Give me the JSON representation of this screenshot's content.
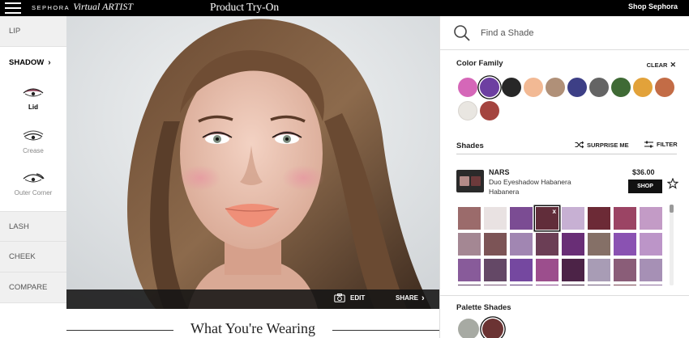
{
  "topbar": {
    "brand_line1": "SEPHORA",
    "brand_line2": "Virtual ARTIST",
    "title": "Product Try-On",
    "shop_link": "Shop Sephora"
  },
  "left_nav": {
    "lip": "LIP",
    "shadow": "SHADOW",
    "shadow_sub": [
      "Lid",
      "Crease",
      "Outer Corner"
    ],
    "lash": "LASH",
    "cheek": "CHEEK",
    "compare": "COMPARE",
    "selected_sub": "Lid"
  },
  "photo_bar": {
    "edit": "EDIT",
    "share": "SHARE"
  },
  "wearing_heading": "What You're Wearing",
  "search": {
    "placeholder": "Find a Shade"
  },
  "color_family": {
    "label": "Color Family",
    "clear": "CLEAR",
    "swatches": [
      "#d567b8",
      "#6d3fa1",
      "#272727",
      "#f2b994",
      "#b09078",
      "#3d3f86",
      "#646464",
      "#3f6a35",
      "#e2a23a",
      "#c36c46",
      "#e9e6e1",
      "#a4443f"
    ],
    "selected_index": 1
  },
  "shades": {
    "label": "Shades",
    "surprise": "SURPRISE ME",
    "filter": "FILTER"
  },
  "product": {
    "brand": "NARS",
    "name": "Duo Eyeshadow Habanera",
    "shade": "Habanera",
    "price": "$36.00",
    "shop_button": "SHOP"
  },
  "shade_grid": {
    "colors": [
      "#9b6b6b",
      "#e9e2e2",
      "#7b4c93",
      "#612d3a",
      "#c7b0d3",
      "#6c2a36",
      "#9b4464",
      "#c39bc6",
      "#a48793",
      "#7c5456",
      "#a186b2",
      "#6b3e55",
      "#692e76",
      "#857067",
      "#8a52b2",
      "#bc95c8",
      "#885b9a",
      "#644866",
      "#7548a0",
      "#9c4e8d",
      "#4c2347",
      "#a89cb5",
      "#8a5d78",
      "#a690b5",
      "#5a3a62",
      "#7b5a7b",
      "#5d3a7a",
      "#8a4b8f",
      "#3c1c3c",
      "#6f5b7c",
      "#76424f",
      "#8e6f9e"
    ],
    "selected_index": 3,
    "selected_mark": "x"
  },
  "palette": {
    "label": "Palette Shades",
    "swatches": [
      "#a7aaa3",
      "#6b3333"
    ],
    "selected_index": 1
  }
}
